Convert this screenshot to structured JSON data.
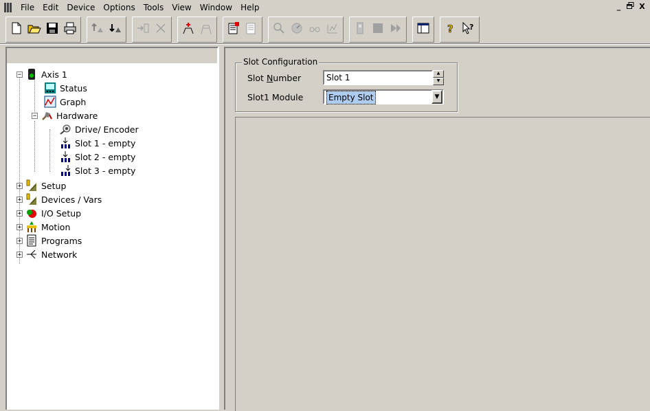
{
  "menu": {
    "items": [
      "File",
      "Edit",
      "Device",
      "Options",
      "Tools",
      "View",
      "Window",
      "Help"
    ]
  },
  "window_controls": {
    "minimize": "_",
    "restore": "ə",
    "close": "X"
  },
  "toolbar": {
    "groups": [
      [
        "new-doc-icon",
        "open-folder-icon",
        "save-icon",
        "print-icon"
      ],
      [
        "upload-icon",
        "download-icon"
      ],
      [
        "connect-icon",
        "disconnect-icon"
      ],
      [
        "add-axis-icon",
        "remove-axis-icon"
      ],
      [
        "compile-icon",
        "properties-icon"
      ],
      [
        "zoom-icon",
        "monitor-icon",
        "scope-icon",
        "graph-tool-icon"
      ],
      [
        "device-icon",
        "stop-icon",
        "play-icon"
      ],
      [
        "window-icon"
      ],
      [
        "help-icon",
        "context-help-icon"
      ]
    ]
  },
  "tree": {
    "root": "Axis 1",
    "items": [
      {
        "label": "Status",
        "icon": "status-icon"
      },
      {
        "label": "Graph",
        "icon": "graph-icon"
      },
      {
        "label": "Hardware",
        "icon": "hardware-icon"
      },
      {
        "label": "Drive/ Encoder",
        "icon": "encoder-icon"
      },
      {
        "label": "Slot 1 - empty",
        "icon": "slot-icon"
      },
      {
        "label": "Slot 2 - empty",
        "icon": "slot-icon"
      },
      {
        "label": "Slot 3 - empty",
        "icon": "slot-icon"
      },
      {
        "label": "Setup",
        "icon": "setup-icon"
      },
      {
        "label": "Devices / Vars",
        "icon": "devices-icon"
      },
      {
        "label": "I/O Setup",
        "icon": "io-icon"
      },
      {
        "label": "Motion",
        "icon": "motion-icon"
      },
      {
        "label": "Programs",
        "icon": "programs-icon"
      },
      {
        "label": "Network",
        "icon": "network-icon"
      }
    ]
  },
  "slot_config": {
    "title": "Slot Configuration",
    "slot_number_label": "Slot Number",
    "slot_number_value": "Slot 1",
    "module_label": "Slot1 Module",
    "module_value": "Empty Slot"
  }
}
